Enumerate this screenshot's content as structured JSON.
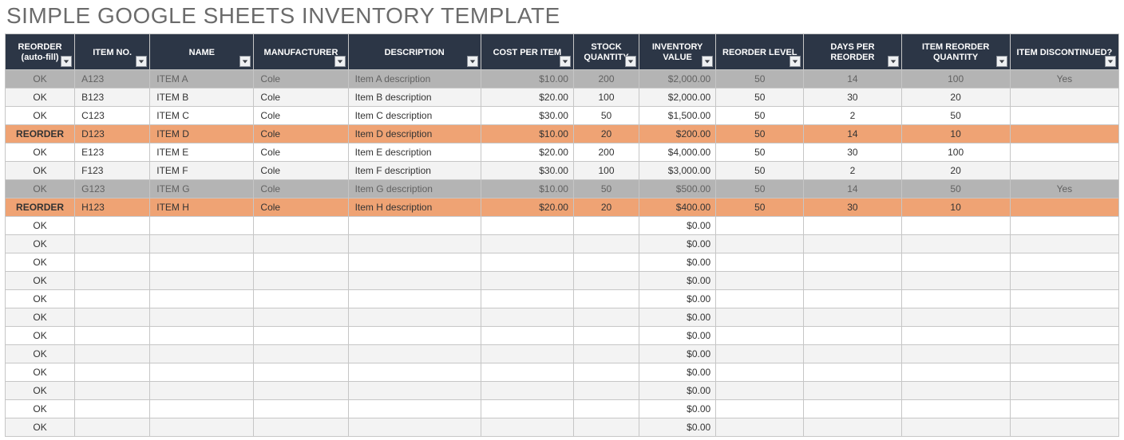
{
  "title": "SIMPLE GOOGLE SHEETS INVENTORY TEMPLATE",
  "headers": [
    "REORDER (auto-fill)",
    "ITEM NO.",
    "NAME",
    "MANUFACTURER",
    "DESCRIPTION",
    "COST PER ITEM",
    "STOCK QUANTITY",
    "INVENTORY VALUE",
    "REORDER LEVEL",
    "DAYS PER REORDER",
    "ITEM REORDER QUANTITY",
    "ITEM DISCONTINUED?"
  ],
  "rows": [
    {
      "status": "OK",
      "item_no": "A123",
      "name": "ITEM A",
      "mfr": "Cole",
      "desc": "Item A description",
      "cost": "$10.00",
      "stock": "200",
      "inv": "$2,000.00",
      "reorder_level": "50",
      "days": "14",
      "reorder_qty": "100",
      "disc": "Yes",
      "state": "discontinued"
    },
    {
      "status": "OK",
      "item_no": "B123",
      "name": "ITEM B",
      "mfr": "Cole",
      "desc": "Item B description",
      "cost": "$20.00",
      "stock": "100",
      "inv": "$2,000.00",
      "reorder_level": "50",
      "days": "30",
      "reorder_qty": "20",
      "disc": "",
      "state": "normal"
    },
    {
      "status": "OK",
      "item_no": "C123",
      "name": "ITEM C",
      "mfr": "Cole",
      "desc": "Item C description",
      "cost": "$30.00",
      "stock": "50",
      "inv": "$1,500.00",
      "reorder_level": "50",
      "days": "2",
      "reorder_qty": "50",
      "disc": "",
      "state": "normal"
    },
    {
      "status": "REORDER",
      "item_no": "D123",
      "name": "ITEM D",
      "mfr": "Cole",
      "desc": "Item D description",
      "cost": "$10.00",
      "stock": "20",
      "inv": "$200.00",
      "reorder_level": "50",
      "days": "14",
      "reorder_qty": "10",
      "disc": "",
      "state": "reorder"
    },
    {
      "status": "OK",
      "item_no": "E123",
      "name": "ITEM E",
      "mfr": "Cole",
      "desc": "Item E description",
      "cost": "$20.00",
      "stock": "200",
      "inv": "$4,000.00",
      "reorder_level": "50",
      "days": "30",
      "reorder_qty": "100",
      "disc": "",
      "state": "normal"
    },
    {
      "status": "OK",
      "item_no": "F123",
      "name": "ITEM F",
      "mfr": "Cole",
      "desc": "Item F description",
      "cost": "$30.00",
      "stock": "100",
      "inv": "$3,000.00",
      "reorder_level": "50",
      "days": "2",
      "reorder_qty": "20",
      "disc": "",
      "state": "normal"
    },
    {
      "status": "OK",
      "item_no": "G123",
      "name": "ITEM G",
      "mfr": "Cole",
      "desc": "Item G description",
      "cost": "$10.00",
      "stock": "50",
      "inv": "$500.00",
      "reorder_level": "50",
      "days": "14",
      "reorder_qty": "50",
      "disc": "Yes",
      "state": "discontinued"
    },
    {
      "status": "REORDER",
      "item_no": "H123",
      "name": "ITEM H",
      "mfr": "Cole",
      "desc": "Item H description",
      "cost": "$20.00",
      "stock": "20",
      "inv": "$400.00",
      "reorder_level": "50",
      "days": "30",
      "reorder_qty": "10",
      "disc": "",
      "state": "reorder"
    },
    {
      "status": "OK",
      "item_no": "",
      "name": "",
      "mfr": "",
      "desc": "",
      "cost": "",
      "stock": "",
      "inv": "$0.00",
      "reorder_level": "",
      "days": "",
      "reorder_qty": "",
      "disc": "",
      "state": "normal"
    },
    {
      "status": "OK",
      "item_no": "",
      "name": "",
      "mfr": "",
      "desc": "",
      "cost": "",
      "stock": "",
      "inv": "$0.00",
      "reorder_level": "",
      "days": "",
      "reorder_qty": "",
      "disc": "",
      "state": "normal"
    },
    {
      "status": "OK",
      "item_no": "",
      "name": "",
      "mfr": "",
      "desc": "",
      "cost": "",
      "stock": "",
      "inv": "$0.00",
      "reorder_level": "",
      "days": "",
      "reorder_qty": "",
      "disc": "",
      "state": "normal"
    },
    {
      "status": "OK",
      "item_no": "",
      "name": "",
      "mfr": "",
      "desc": "",
      "cost": "",
      "stock": "",
      "inv": "$0.00",
      "reorder_level": "",
      "days": "",
      "reorder_qty": "",
      "disc": "",
      "state": "normal"
    },
    {
      "status": "OK",
      "item_no": "",
      "name": "",
      "mfr": "",
      "desc": "",
      "cost": "",
      "stock": "",
      "inv": "$0.00",
      "reorder_level": "",
      "days": "",
      "reorder_qty": "",
      "disc": "",
      "state": "normal"
    },
    {
      "status": "OK",
      "item_no": "",
      "name": "",
      "mfr": "",
      "desc": "",
      "cost": "",
      "stock": "",
      "inv": "$0.00",
      "reorder_level": "",
      "days": "",
      "reorder_qty": "",
      "disc": "",
      "state": "normal"
    },
    {
      "status": "OK",
      "item_no": "",
      "name": "",
      "mfr": "",
      "desc": "",
      "cost": "",
      "stock": "",
      "inv": "$0.00",
      "reorder_level": "",
      "days": "",
      "reorder_qty": "",
      "disc": "",
      "state": "normal"
    },
    {
      "status": "OK",
      "item_no": "",
      "name": "",
      "mfr": "",
      "desc": "",
      "cost": "",
      "stock": "",
      "inv": "$0.00",
      "reorder_level": "",
      "days": "",
      "reorder_qty": "",
      "disc": "",
      "state": "normal"
    },
    {
      "status": "OK",
      "item_no": "",
      "name": "",
      "mfr": "",
      "desc": "",
      "cost": "",
      "stock": "",
      "inv": "$0.00",
      "reorder_level": "",
      "days": "",
      "reorder_qty": "",
      "disc": "",
      "state": "normal"
    },
    {
      "status": "OK",
      "item_no": "",
      "name": "",
      "mfr": "",
      "desc": "",
      "cost": "",
      "stock": "",
      "inv": "$0.00",
      "reorder_level": "",
      "days": "",
      "reorder_qty": "",
      "disc": "",
      "state": "normal"
    },
    {
      "status": "OK",
      "item_no": "",
      "name": "",
      "mfr": "",
      "desc": "",
      "cost": "",
      "stock": "",
      "inv": "$0.00",
      "reorder_level": "",
      "days": "",
      "reorder_qty": "",
      "disc": "",
      "state": "normal"
    },
    {
      "status": "OK",
      "item_no": "",
      "name": "",
      "mfr": "",
      "desc": "",
      "cost": "",
      "stock": "",
      "inv": "$0.00",
      "reorder_level": "",
      "days": "",
      "reorder_qty": "",
      "disc": "",
      "state": "normal"
    }
  ]
}
